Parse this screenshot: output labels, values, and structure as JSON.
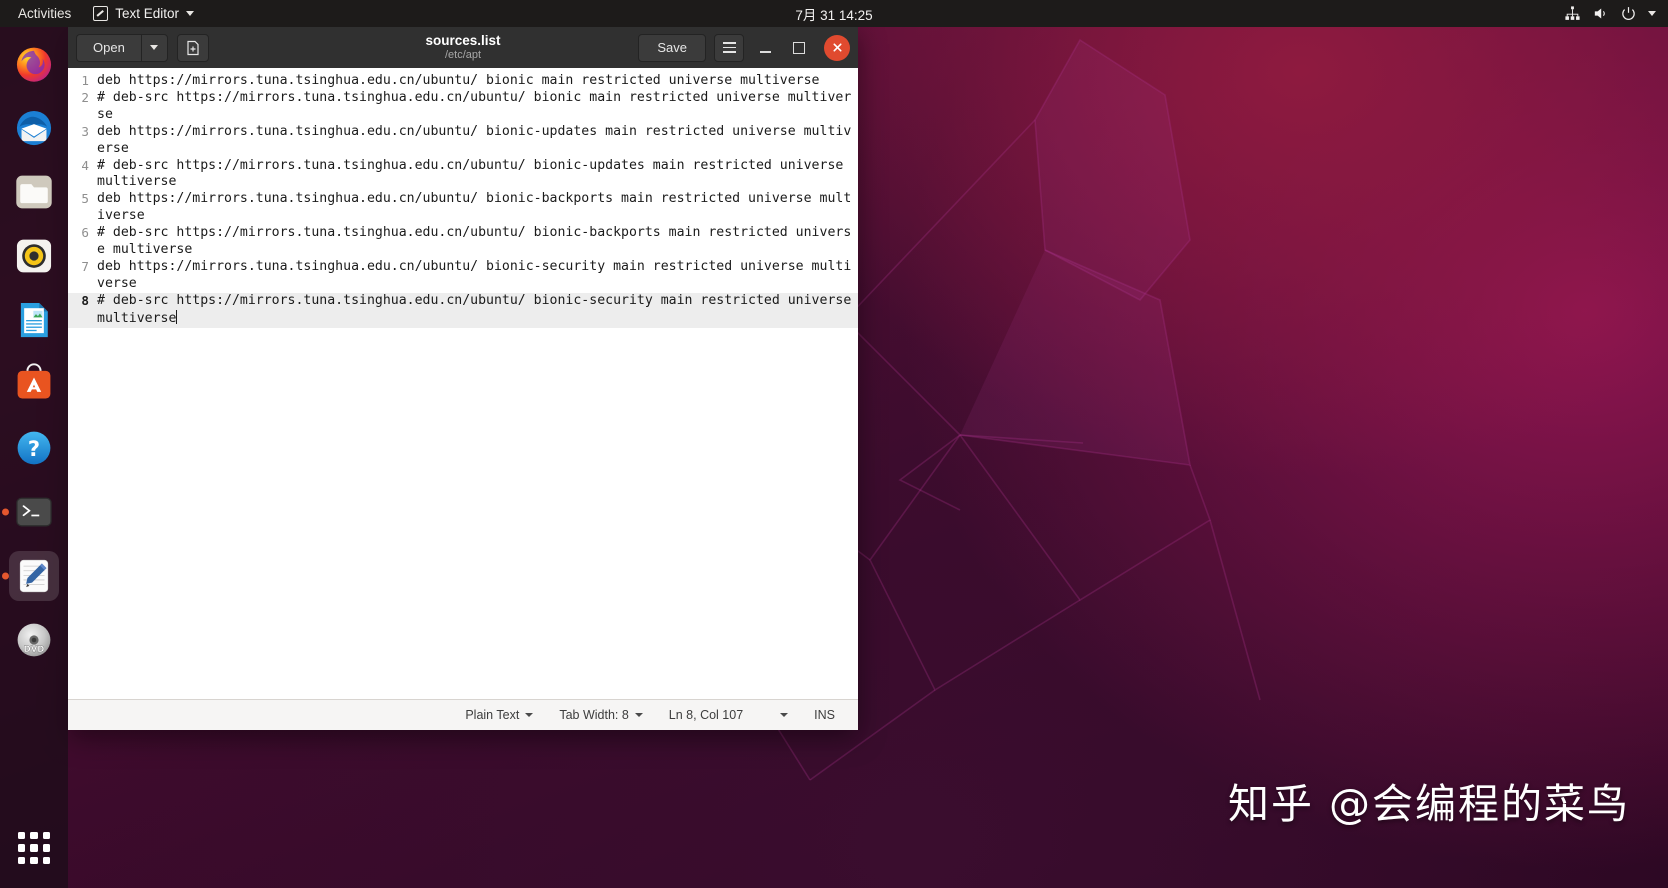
{
  "topbar": {
    "activities": "Activities",
    "app_menu_label": "Text Editor",
    "clock": "7月 31  14:25",
    "tray": [
      "network-icon",
      "volume-icon",
      "power-icon",
      "caret-down-icon"
    ]
  },
  "dock": {
    "items": [
      {
        "name": "firefox",
        "label": "Firefox",
        "running": false,
        "active": false
      },
      {
        "name": "thunderbird",
        "label": "Thunderbird Mail",
        "running": false,
        "active": false
      },
      {
        "name": "files",
        "label": "Files",
        "running": false,
        "active": false
      },
      {
        "name": "rhythmbox",
        "label": "Rhythmbox",
        "running": false,
        "active": false
      },
      {
        "name": "libreoffice-writer",
        "label": "LibreOffice Writer",
        "running": false,
        "active": false
      },
      {
        "name": "ubuntu-software",
        "label": "Ubuntu Software",
        "running": false,
        "active": false
      },
      {
        "name": "help",
        "label": "Help",
        "running": false,
        "active": false
      },
      {
        "name": "terminal",
        "label": "Terminal",
        "running": true,
        "active": false
      },
      {
        "name": "text-editor",
        "label": "Text Editor",
        "running": true,
        "active": true
      },
      {
        "name": "dvd",
        "label": "DVD",
        "running": false,
        "active": false
      }
    ],
    "show_applications_label": "Show Applications"
  },
  "window": {
    "title": "sources.list",
    "subtitle": "/etc/apt",
    "open_label": "Open",
    "save_label": "Save",
    "new_document_label": "New Document",
    "menu_label": "Main Menu",
    "minimize_label": "Minimize",
    "maximize_label": "Maximize",
    "close_label": "Close"
  },
  "editor": {
    "lines": [
      {
        "n": "1",
        "text": "deb https://mirrors.tuna.tsinghua.edu.cn/ubuntu/ bionic main restricted universe multiverse"
      },
      {
        "n": "2",
        "text": "# deb-src https://mirrors.tuna.tsinghua.edu.cn/ubuntu/ bionic main restricted universe multiverse"
      },
      {
        "n": "3",
        "text": "deb https://mirrors.tuna.tsinghua.edu.cn/ubuntu/ bionic-updates main restricted universe multiverse"
      },
      {
        "n": "4",
        "text": "# deb-src https://mirrors.tuna.tsinghua.edu.cn/ubuntu/ bionic-updates main restricted universe multiverse"
      },
      {
        "n": "5",
        "text": "deb https://mirrors.tuna.tsinghua.edu.cn/ubuntu/ bionic-backports main restricted universe multiverse"
      },
      {
        "n": "6",
        "text": "# deb-src https://mirrors.tuna.tsinghua.edu.cn/ubuntu/ bionic-backports main restricted universe multiverse"
      },
      {
        "n": "7",
        "text": "deb https://mirrors.tuna.tsinghua.edu.cn/ubuntu/ bionic-security main restricted universe multiverse"
      },
      {
        "n": "8",
        "text": "# deb-src https://mirrors.tuna.tsinghua.edu.cn/ubuntu/ bionic-security main restricted universe multiverse"
      }
    ],
    "current_line_index": 7
  },
  "statusbar": {
    "language": "Plain Text",
    "tab_width": "Tab Width: 8",
    "position": "Ln 8, Col 107",
    "insert_mode": "INS"
  },
  "watermark": "知乎 @会编程的菜鸟",
  "colors": {
    "topbar_bg": "#1d1b1a",
    "titlebar_bg": "#303030",
    "close_red": "#e04a2f",
    "editor_bg": "#ffffff",
    "statusbar_bg": "#f6f5f4",
    "dock_bg": "rgba(26,12,24,0.72)",
    "running_dot": "#e4572e"
  }
}
